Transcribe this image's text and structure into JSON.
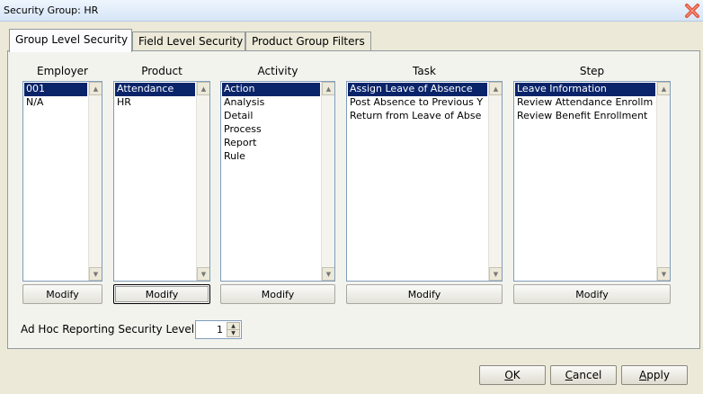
{
  "window": {
    "title": "Security Group: HR"
  },
  "tabs": [
    {
      "label": "Group Level Security"
    },
    {
      "label": "Field Level Security"
    },
    {
      "label": "Product Group Filters"
    }
  ],
  "columns": {
    "employer": {
      "header": "Employer",
      "items": [
        "001",
        "N/A"
      ],
      "selected": "001",
      "modify": "Modify"
    },
    "product": {
      "header": "Product",
      "items": [
        "Attendance",
        "HR"
      ],
      "selected": "Attendance",
      "modify": "Modify"
    },
    "activity": {
      "header": "Activity",
      "items": [
        "Action",
        "Analysis",
        "Detail",
        "Process",
        "Report",
        "Rule"
      ],
      "selected": "Action",
      "modify": "Modify"
    },
    "task": {
      "header": "Task",
      "items": [
        "Assign Leave of Absence",
        "Post Absence to Previous Y",
        "Return from Leave of Abse"
      ],
      "selected": "Assign Leave of Absence",
      "modify": "Modify"
    },
    "step": {
      "header": "Step",
      "items": [
        "Leave Information",
        "Review Attendance Enrollm",
        "Review Benefit Enrollment"
      ],
      "selected": "Leave Information",
      "modify": "Modify"
    }
  },
  "adhoc": {
    "label": "Ad Hoc Reporting Security Level",
    "value": "1"
  },
  "buttons": {
    "ok": {
      "accel": "O",
      "rest": "K"
    },
    "cancel": {
      "accel": "C",
      "rest": "ancel"
    },
    "apply": {
      "accel": "A",
      "rest": "pply"
    }
  },
  "icons": {
    "close": "close-x-icon",
    "scroll_up": "arrow-up-icon",
    "scroll_down": "arrow-down-icon"
  },
  "colors": {
    "selection": "#0a246a",
    "close": "#e0533b"
  }
}
